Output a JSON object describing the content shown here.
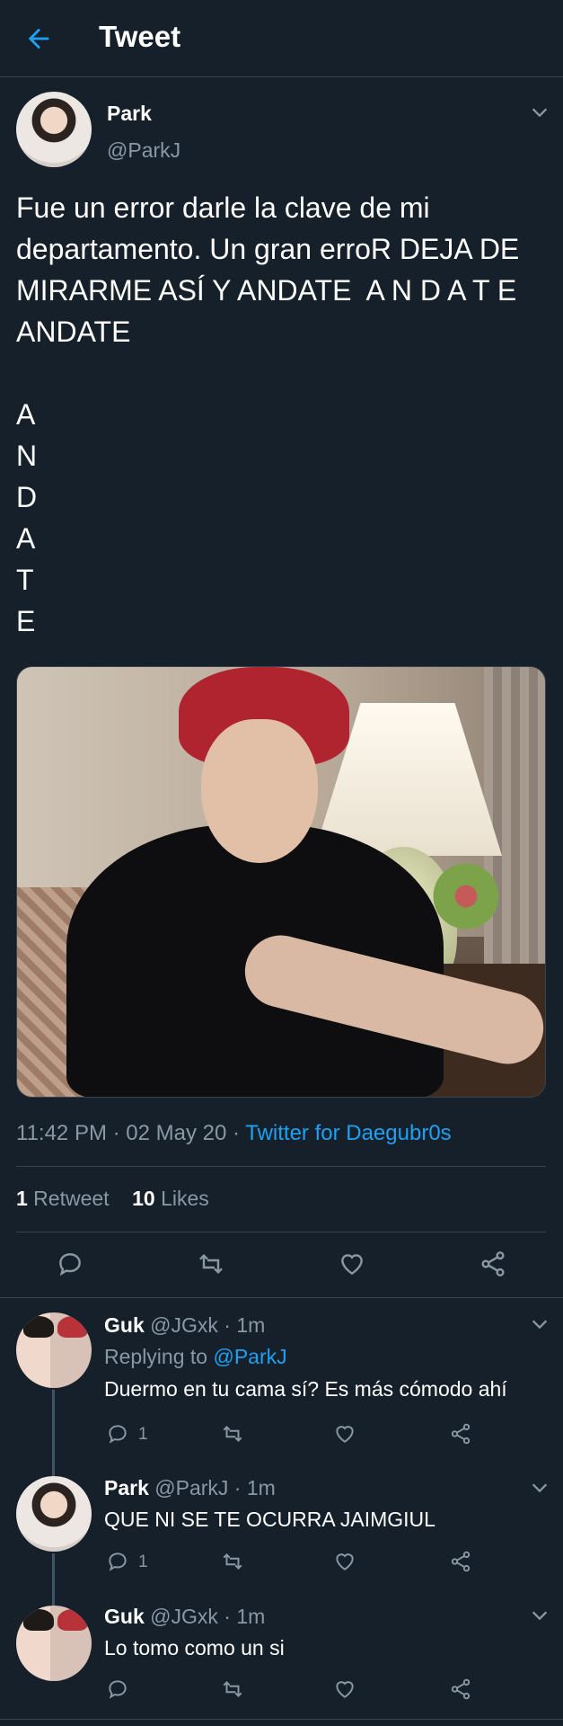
{
  "header": {
    "title": "Tweet"
  },
  "main_tweet": {
    "name": "Park",
    "handle": "@ParkJ",
    "text": "Fue un error darle la clave de mi departamento. Un gran erroR DEJA DE MIRARME ASÍ Y ANDATE  A N D A T E  ANDATE\n\nA\nN\nD\nA\nT\nE",
    "time_date": "11:42 PM · 02 May 20 · ",
    "source": "Twitter for Daegubr0s",
    "retweets": "1",
    "retweets_label": " Retweet",
    "likes": "10",
    "likes_label": " Likes"
  },
  "replies": [
    {
      "name": "Guk",
      "handle": "@JGxk",
      "time": " · 1m",
      "replying_to_label": "Replying to ",
      "replying_to": "@ParkJ",
      "text": "Duermo en tu cama sí? Es más cómodo ahí",
      "reply_count": "1"
    },
    {
      "name": "Park",
      "handle": "@ParkJ",
      "time": " · 1m",
      "text": "QUE NI SE TE OCURRA JAIMGIUL",
      "reply_count": "1"
    },
    {
      "name": "Guk",
      "handle": "@JGxk",
      "time": " · 1m",
      "text": "Lo tomo como un si",
      "reply_count": ""
    }
  ],
  "colors": {
    "background": "#15202b",
    "accent": "#1da1f2",
    "secondary_text": "#8899a6",
    "divider": "#38444d"
  },
  "icons": [
    "back-arrow-icon",
    "chevron-down-icon",
    "reply-icon",
    "retweet-icon",
    "like-icon",
    "share-icon"
  ]
}
